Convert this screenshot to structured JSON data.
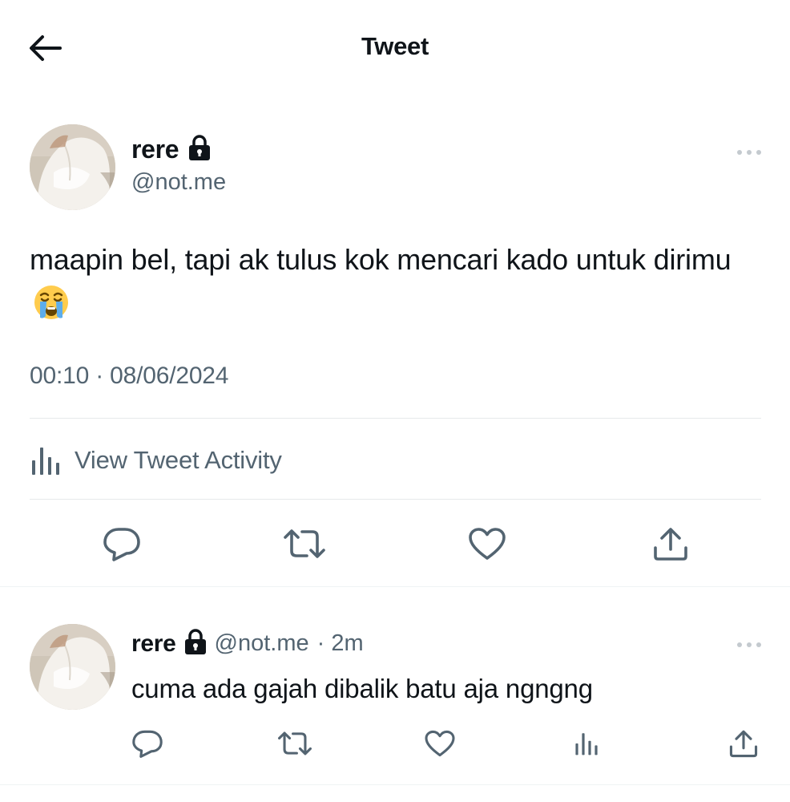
{
  "header": {
    "title": "Tweet",
    "back_icon": "arrow-left-icon"
  },
  "tweet": {
    "display_name": "rere",
    "handle": "@not.me",
    "text": "maapin bel, tapi ak tulus kok mencari kado untuk dirimu",
    "emoji": "loudly-crying-face",
    "timestamp": "00:10 · 08/06/2024",
    "activity_label": "View Tweet Activity",
    "actions": [
      "reply-icon",
      "retweet-icon",
      "like-icon",
      "share-icon"
    ]
  },
  "reply": {
    "display_name": "rere",
    "handle": "@not.me",
    "time": "· 2m",
    "text": "cuma ada gajah dibalik batu aja ngngng",
    "actions": [
      "reply-icon",
      "retweet-icon",
      "like-icon",
      "analytics-icon",
      "share-icon"
    ]
  },
  "colors": {
    "text": "#0f1419",
    "secondary": "#536471",
    "divider": "#eff3f4",
    "background": "#ffffff"
  }
}
